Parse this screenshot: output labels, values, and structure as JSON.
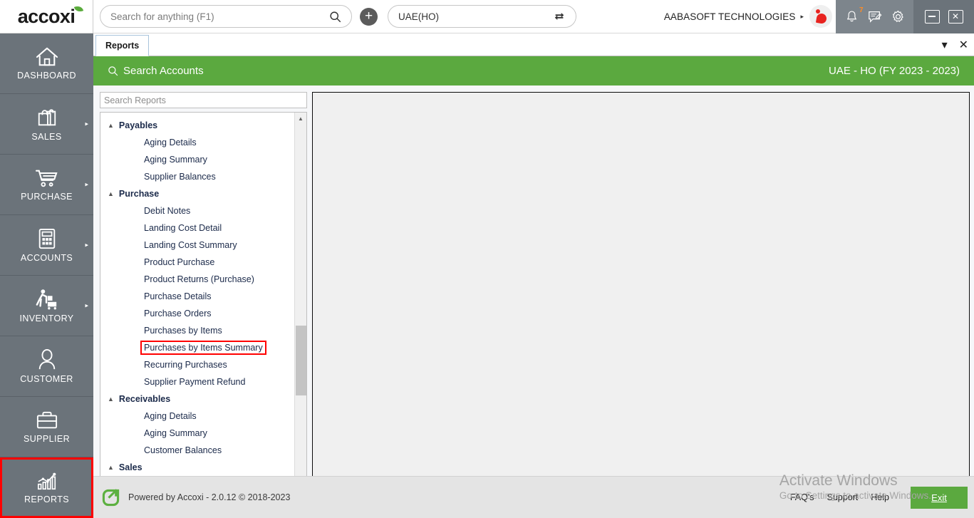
{
  "brand": {
    "name": "accoxi",
    "accent_green": "#5ba93f",
    "nav_gray": "#6b737a",
    "highlight_red": "#ff0000"
  },
  "topbar": {
    "search": {
      "placeholder": "Search for anything (F1)",
      "value": "",
      "icon": "search-icon"
    },
    "add_button_label": "+",
    "branch": {
      "value": "UAE(HO)",
      "switch_icon": "switch-branch-icon"
    },
    "company": {
      "name": "AABASOFT TECHNOLOGIES",
      "caret": "▸",
      "logo_icon": "company-logo-icon"
    },
    "system_icons": [
      {
        "name": "notification-bell-icon",
        "badge": "7"
      },
      {
        "name": "message-icon",
        "badge": ""
      },
      {
        "name": "settings-gear-icon",
        "badge": ""
      }
    ],
    "window_controls": [
      {
        "name": "minimize-button",
        "glyph": "–"
      },
      {
        "name": "close-button",
        "glyph": "✕"
      }
    ]
  },
  "sidebar": {
    "items": [
      {
        "label": "DASHBOARD",
        "icon": "home-icon",
        "has_arrow": false,
        "highlighted": false
      },
      {
        "label": "SALES",
        "icon": "shopping-bag-icon",
        "has_arrow": true,
        "highlighted": false
      },
      {
        "label": "PURCHASE",
        "icon": "shopping-cart-icon",
        "has_arrow": true,
        "highlighted": false
      },
      {
        "label": "ACCOUNTS",
        "icon": "calculator-icon",
        "has_arrow": true,
        "highlighted": false
      },
      {
        "label": "INVENTORY",
        "icon": "warehouse-worker-icon",
        "has_arrow": true,
        "highlighted": false
      },
      {
        "label": "CUSTOMER",
        "icon": "person-icon",
        "has_arrow": false,
        "highlighted": false
      },
      {
        "label": "SUPPLIER",
        "icon": "briefcase-icon",
        "has_arrow": false,
        "highlighted": false
      },
      {
        "label": "REPORTS",
        "icon": "bar-chart-icon",
        "has_arrow": false,
        "highlighted": true
      }
    ]
  },
  "tabstrip": {
    "tabs": [
      {
        "label": "Reports",
        "active": true
      }
    ],
    "dropdown_icon": "▾",
    "close_icon": "✕"
  },
  "green_header": {
    "title": "Search Accounts",
    "search_icon": "search-icon",
    "context": "UAE - HO (FY 2023 - 2023)"
  },
  "reports_panel": {
    "search": {
      "placeholder": "Search Reports",
      "value": ""
    },
    "groups": [
      {
        "name": "Payables",
        "expanded": true,
        "items": [
          {
            "label": "Aging Details",
            "marked": false
          },
          {
            "label": "Aging Summary",
            "marked": false
          },
          {
            "label": "Supplier Balances",
            "marked": false
          }
        ]
      },
      {
        "name": "Purchase",
        "expanded": true,
        "items": [
          {
            "label": "Debit Notes",
            "marked": false
          },
          {
            "label": "Landing Cost Detail",
            "marked": false
          },
          {
            "label": "Landing Cost Summary",
            "marked": false
          },
          {
            "label": "Product Purchase",
            "marked": false
          },
          {
            "label": "Product Returns (Purchase)",
            "marked": false
          },
          {
            "label": "Purchase Details",
            "marked": false
          },
          {
            "label": "Purchase Orders",
            "marked": false
          },
          {
            "label": "Purchases by Items",
            "marked": false
          },
          {
            "label": "Purchases by Items Summary",
            "marked": true
          },
          {
            "label": "Recurring Purchases",
            "marked": false
          },
          {
            "label": "Supplier Payment Refund",
            "marked": false
          }
        ]
      },
      {
        "name": "Receivables",
        "expanded": true,
        "items": [
          {
            "label": "Aging Details",
            "marked": false
          },
          {
            "label": "Aging Summary",
            "marked": false
          },
          {
            "label": "Customer Balances",
            "marked": false
          }
        ]
      },
      {
        "name": "Sales",
        "expanded": true,
        "items": []
      }
    ],
    "scrollbar": {
      "up_icon": "▲",
      "down_icon": "▼",
      "thumb_top_pct": 58,
      "thumb_height_pct": 20
    }
  },
  "content_panel": {
    "empty": true
  },
  "footer": {
    "powered_by": "Powered by Accoxi - 2.0.12 © 2018-2023",
    "logo_icon": "accoxi-arrow-icon",
    "links": [
      "FAQ's",
      "Support",
      "Help"
    ],
    "exit_label": "Exit"
  },
  "watermark": {
    "line1": "Activate Windows",
    "line2": "Go to Settings to activate Windows."
  }
}
